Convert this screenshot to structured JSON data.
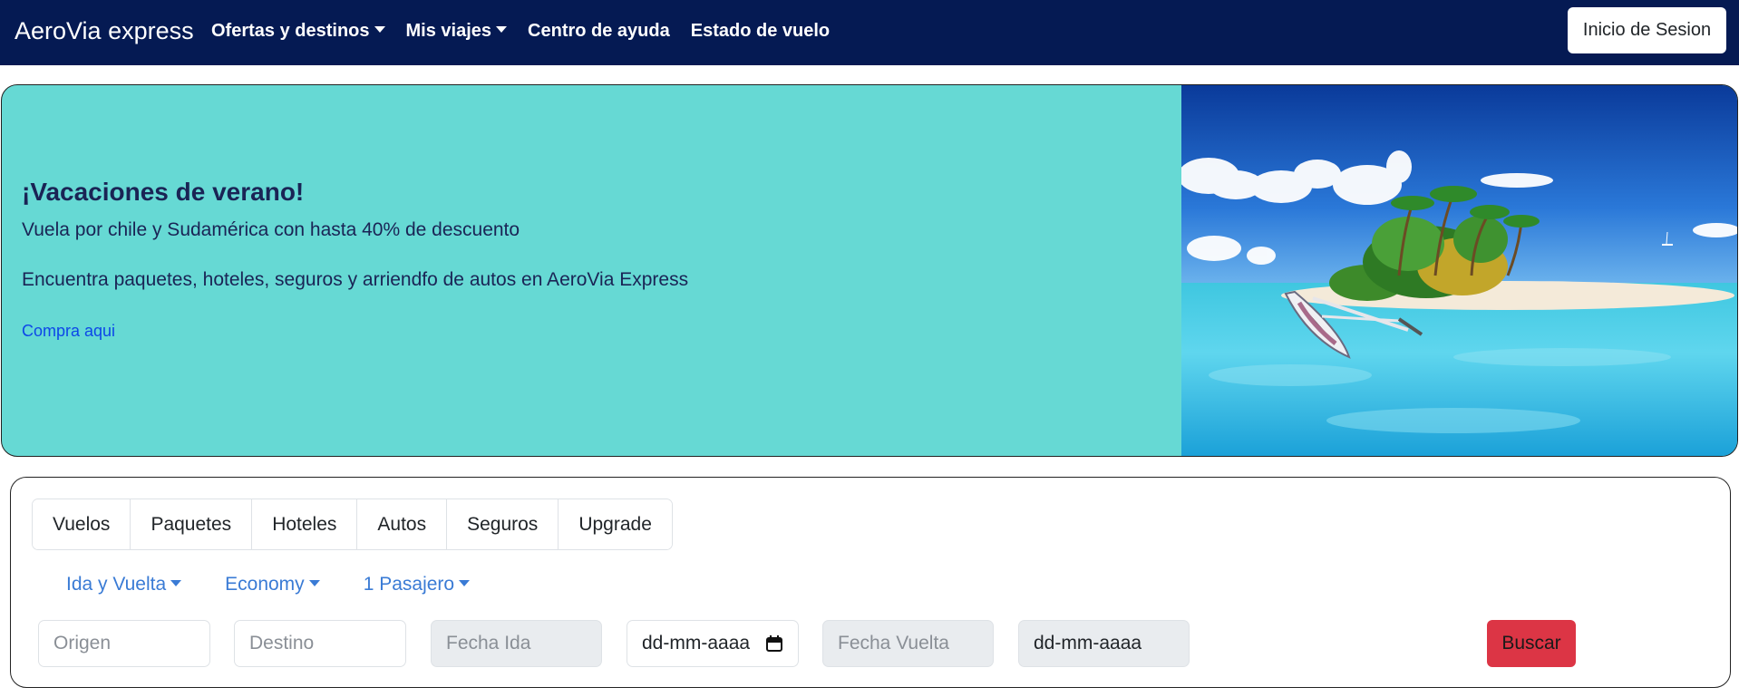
{
  "navbar": {
    "brand": "AeroVia express",
    "links": [
      {
        "label": "Ofertas y destinos",
        "dropdown": true
      },
      {
        "label": "Mis viajes",
        "dropdown": true
      },
      {
        "label": "Centro de ayuda",
        "dropdown": false
      },
      {
        "label": "Estado de vuelo",
        "dropdown": false
      }
    ],
    "login_label": "Inicio de Sesion"
  },
  "hero": {
    "title": "¡Vacaciones de verano!",
    "subtitle": "Vuela por chile y Sudamérica con hasta 40% de descuento",
    "description": "Encuentra paquetes, hoteles, seguros y arriendfo de autos en AeroVia Express",
    "link": "Compra aqui",
    "image_icon": "tropical-island-image"
  },
  "search": {
    "tabs": [
      "Vuelos",
      "Paquetes",
      "Hoteles",
      "Autos",
      "Seguros",
      "Upgrade"
    ],
    "options": {
      "trip_type": "Ida y Vuelta",
      "cabin": "Economy",
      "passengers": "1 Pasajero"
    },
    "origin_placeholder": "Origen",
    "destination_placeholder": "Destino",
    "date_out_label": "Fecha Ida",
    "date_out_value": "dd-mm-aaaa",
    "date_return_label": "Fecha Vuelta",
    "date_return_value": "dd-mm-aaaa",
    "search_label": "Buscar"
  },
  "colors": {
    "navbar_bg": "#051a53",
    "hero_bg": "#66d9d4",
    "link": "#0d47e8",
    "accent": "#3a7bd5",
    "danger": "#dc3545"
  }
}
